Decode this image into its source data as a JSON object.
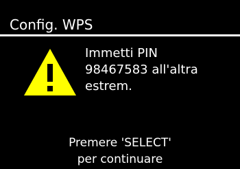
{
  "header": {
    "title": "Config. WPS"
  },
  "dialog": {
    "icon": "warning-triangle-icon",
    "icon_color": "#ffff00",
    "message_lines": [
      "Immetti PIN",
      "98467583 all'altra",
      "estrem."
    ],
    "prompt_lines": [
      "Premere 'SELECT'",
      "per continuare"
    ]
  }
}
